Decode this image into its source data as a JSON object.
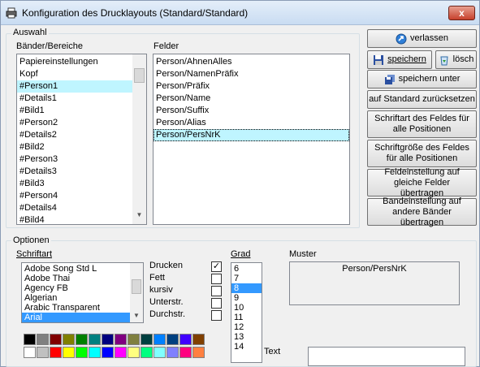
{
  "window": {
    "title": "Konfiguration des Drucklayouts (Standard/Standard)",
    "close_glyph": "x"
  },
  "auswahl": {
    "legend": "Auswahl",
    "baender_label": "Bänder/Bereiche",
    "baender": [
      "Papiereinstellungen",
      "Kopf",
      "#Person1",
      "#Details1",
      "#Bild1",
      "#Person2",
      "#Details2",
      "#Bild2",
      "#Person3",
      "#Details3",
      "#Bild3",
      "#Person4",
      "#Details4",
      "#Bild4"
    ],
    "baender_selected": "#Person1",
    "felder_label": "Felder",
    "felder": [
      "Person/AhnenAlles",
      "Person/NamenPräfix",
      "Person/Präfix",
      "Person/Name",
      "Person/Suffix",
      "Person/Alias",
      "Person/PersNrK"
    ],
    "felder_selected": "Person/PersNrK"
  },
  "buttons": {
    "verlassen": "verlassen",
    "speichern": "speichern",
    "loeschen": "lösch",
    "speichern_unter": "speichern unter",
    "standard": "auf Standard zurücksetzen",
    "schriftart_alle": "Schriftart des Feldes für alle Positionen",
    "schriftgroesse_alle": "Schriftgröße des Feldes für alle Positionen",
    "feldeinstellung": "Feldeinstellung auf gleiche Felder übertragen",
    "bandeinstellung": "Bandeinstellung auf andere Bänder übertragen"
  },
  "optionen": {
    "legend": "Optionen",
    "schriftart_label": "Schriftart",
    "fonts": [
      "Adobe Song Std L",
      "Adobe Thai",
      "Agency FB",
      "Algerian",
      "Arabic Transparent",
      "Arial"
    ],
    "font_selected": "Arial",
    "checkboxes": [
      {
        "label": "Drucken",
        "checked": true
      },
      {
        "label": "Fett",
        "checked": false
      },
      {
        "label": "kursiv",
        "checked": false
      },
      {
        "label": "Unterstr.",
        "checked": false
      },
      {
        "label": "Durchstr.",
        "checked": false
      }
    ],
    "grad_label": "Grad",
    "sizes": [
      "6",
      "7",
      "8",
      "9",
      "10",
      "11",
      "12",
      "13",
      "14"
    ],
    "size_selected": "8",
    "muster_label": "Muster",
    "muster_text": "Person/PersNrK",
    "text_label": "Text",
    "text_value": "",
    "palette_row1": [
      "#000000",
      "#808080",
      "#800000",
      "#808000",
      "#008000",
      "#008080",
      "#000080",
      "#800080",
      "#808040",
      "#004040",
      "#0080ff",
      "#004080",
      "#4000ff",
      "#804000"
    ],
    "palette_row2": [
      "#ffffff",
      "#c0c0c0",
      "#ff0000",
      "#ffff00",
      "#00ff00",
      "#00ffff",
      "#0000ff",
      "#ff00ff",
      "#ffff80",
      "#00ff80",
      "#80ffff",
      "#8080ff",
      "#ff0080",
      "#ff8040"
    ]
  }
}
